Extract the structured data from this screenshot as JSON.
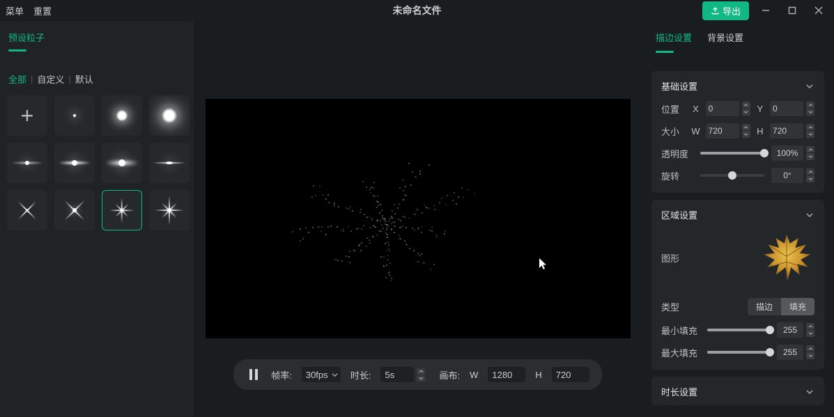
{
  "topbar": {
    "menu": "菜单",
    "reset": "重置",
    "title": "未命名文件",
    "export": "导出"
  },
  "left": {
    "tab": "预设粒子",
    "filters": {
      "all": "全部",
      "custom": "自定义",
      "default": "默认"
    },
    "presets": [
      "add",
      "dot",
      "medium",
      "big",
      "flare1",
      "flare2",
      "flare3",
      "flare4",
      "star1",
      "star2",
      "star3",
      "star4"
    ],
    "selected_index": 10
  },
  "bottom": {
    "fps_label": "帧率:",
    "fps": "30fps",
    "duration_label": "时长:",
    "duration": "5s",
    "canvas_label": "画布:",
    "w_label": "W",
    "w": "1280",
    "h_label": "H",
    "h": "720"
  },
  "right": {
    "tabs": {
      "stroke": "描边设置",
      "background": "背景设置"
    },
    "basic": {
      "title": "基础设置",
      "pos_label": "位置",
      "x_label": "X",
      "x": "0",
      "y_label": "Y",
      "y": "0",
      "size_label": "大小",
      "w_label": "W",
      "w": "720",
      "h_label": "H",
      "h": "720",
      "opacity_label": "透明度",
      "opacity": "100%",
      "opacity_pct": 100,
      "rotation_label": "旋转",
      "rotation": "0°",
      "rotation_pct": 50
    },
    "area": {
      "title": "区域设置",
      "shape_label": "图形",
      "type_label": "类型",
      "stroke_opt": "描边",
      "fill_opt": "填充",
      "min_fill_label": "最小填充",
      "min_fill": "255",
      "min_fill_pct": 100,
      "max_fill_label": "最大填充",
      "max_fill": "255",
      "max_fill_pct": 100
    },
    "duration": {
      "title": "时长设置"
    }
  }
}
